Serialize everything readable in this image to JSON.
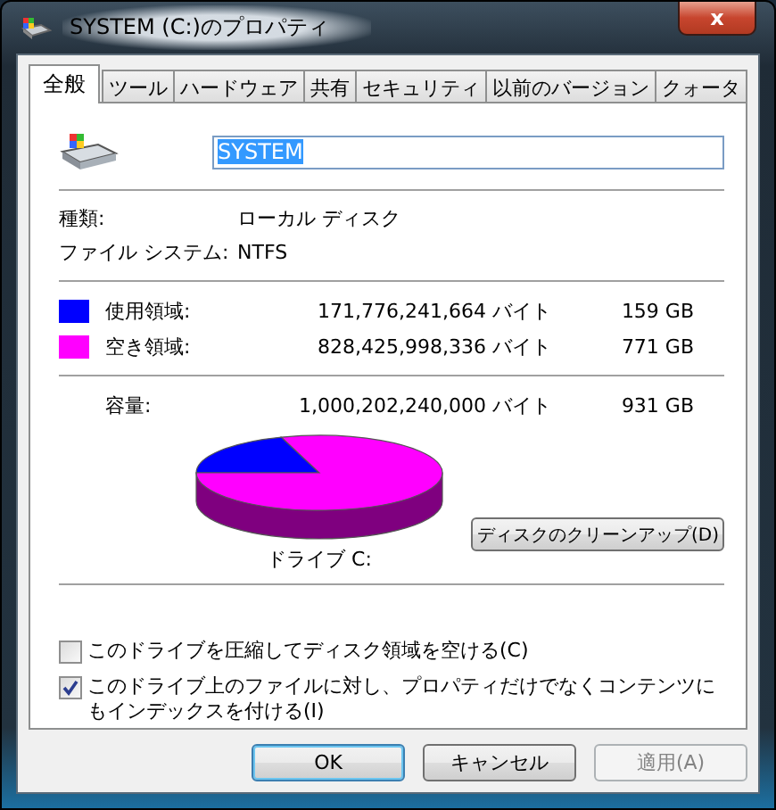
{
  "window": {
    "title": "SYSTEM (C:)のプロパティ",
    "close": "x"
  },
  "tabs": [
    {
      "label": "全般",
      "selected": true
    },
    {
      "label": "ツール",
      "selected": false
    },
    {
      "label": "ハードウェア",
      "selected": false
    },
    {
      "label": "共有",
      "selected": false
    },
    {
      "label": "セキュリティ",
      "selected": false
    },
    {
      "label": "以前のバージョン",
      "selected": false
    },
    {
      "label": "クォータ",
      "selected": false
    }
  ],
  "name_field": {
    "value": "SYSTEM"
  },
  "info": [
    {
      "label": "種類:",
      "value": "ローカル ディスク"
    },
    {
      "label": "ファイル システム:",
      "value": "NTFS"
    }
  ],
  "space": [
    {
      "label": "使用領域:",
      "bytes": "171,776,241,664 バイト",
      "size": "159 GB",
      "color": "#0000ff"
    },
    {
      "label": "空き領域:",
      "bytes": "828,425,998,336 バイト",
      "size": "771 GB",
      "color": "#ff00ff"
    }
  ],
  "capacity": {
    "label": "容量:",
    "bytes": "1,000,202,240,000 バイト",
    "size": "931 GB"
  },
  "drive_label": "ドライブ C:",
  "cleanup_button": "ディスクのクリーンアップ(D)",
  "options": [
    {
      "label": "このドライブを圧縮してディスク領域を空ける(C)",
      "checked": false
    },
    {
      "label": "このドライブ上のファイルに対し、プロパティだけでなくコンテンツにもインデックスを付ける(I)",
      "checked": true
    }
  ],
  "buttons": [
    {
      "label": "OK",
      "disabled": false,
      "default": true
    },
    {
      "label": "キャンセル",
      "disabled": false,
      "default": false
    },
    {
      "label": "適用(A)",
      "disabled": true,
      "default": false
    }
  ]
}
